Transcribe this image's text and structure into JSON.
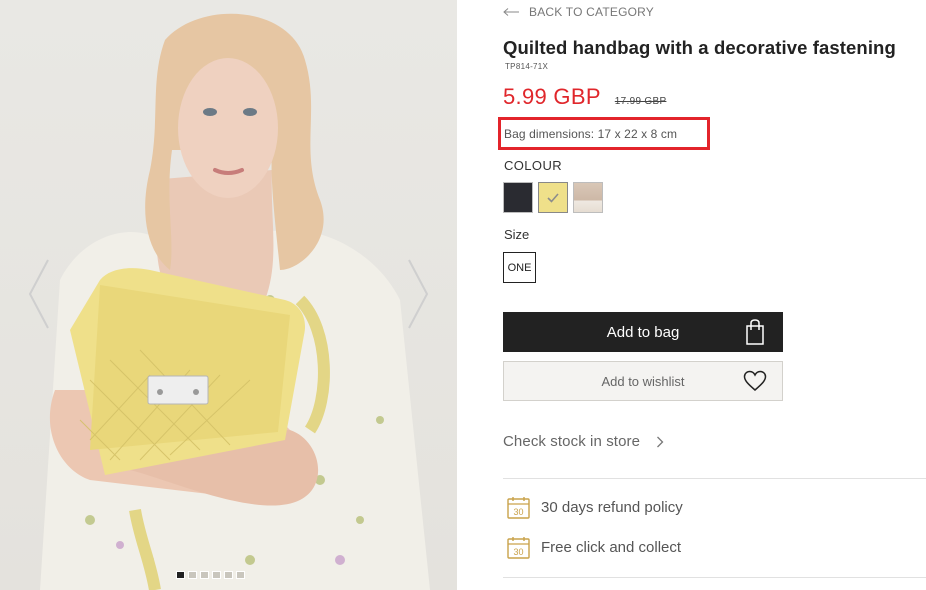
{
  "gallery": {
    "prev_icon": "chevron-left-icon",
    "next_icon": "chevron-right-icon",
    "dots": [
      true,
      false,
      false,
      false,
      false,
      false
    ]
  },
  "back": {
    "label": "BACK TO CATEGORY",
    "icon": "arrow-left-icon"
  },
  "product": {
    "title": "Quilted handbag with a decorative fastening",
    "sku": "TP814-71X",
    "price_current": "5.99 GBP",
    "price_old": "17.99 GBP",
    "dimensions": "Bag dimensions: 17 x 22 x 8 cm"
  },
  "colour": {
    "label": "COLOUR",
    "swatches": [
      {
        "name": "black",
        "color": "#2a2b31",
        "selected": false
      },
      {
        "name": "yellow",
        "color": "#efe08a",
        "selected": true
      },
      {
        "name": "beige",
        "color": "#d6c3b3",
        "selected": false
      }
    ]
  },
  "size": {
    "label": "Size",
    "option": "ONE"
  },
  "actions": {
    "add_to_bag": "Add to bag",
    "add_to_wishlist": "Add to wishlist"
  },
  "stock": {
    "label": "Check stock in store"
  },
  "perks": [
    {
      "icon": "calendar-30-icon",
      "label": "30 days refund policy"
    },
    {
      "icon": "calendar-30-icon",
      "label": "Free click and collect"
    }
  ],
  "colors": {
    "price_red": "#e0262b",
    "highlight_box": "#e3242b",
    "button_dark": "#222222",
    "icon_gold": "#c9a24a"
  }
}
